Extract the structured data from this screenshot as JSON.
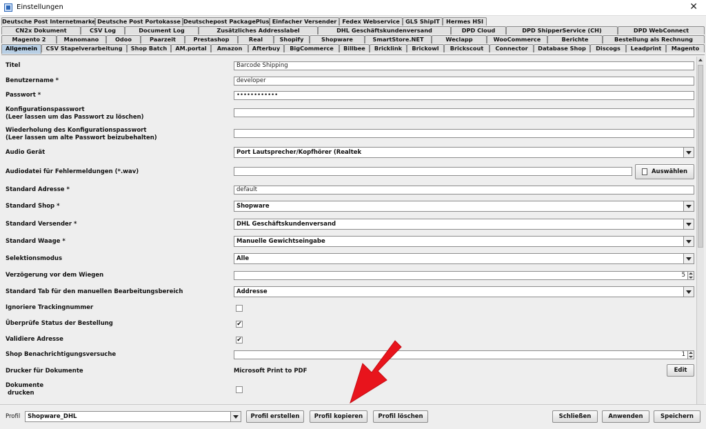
{
  "window": {
    "title": "Einstellungen",
    "close_label": "✕"
  },
  "tabs": {
    "row1": [
      "Deutsche Post Internetmarke",
      "Deutsche Post Portokasse",
      "Deutschepost PackagePlus",
      "Einfacher Versender",
      "Fedex Webservice",
      "GLS ShipIT",
      "Hermes HSI"
    ],
    "row2": [
      "CN2x Dokument",
      "CSV Log",
      "Document Log",
      "Zusätzliches Addresslabel",
      "DHL Geschäftskundenversand",
      "DPD Cloud",
      "DPD ShipperService (CH)",
      "DPD WebConnect"
    ],
    "row3": [
      "Magento 2",
      "Manomano",
      "Odoo",
      "Paarzeit",
      "Prestashop",
      "Real",
      "Shopify",
      "Shopware",
      "SmartStore.NET",
      "Weclapp",
      "WooCommerce",
      "Berichte",
      "Bestellung als Rechnung"
    ],
    "row4": [
      "Allgemein",
      "CSV Stapelverarbeitung",
      "Shop Batch",
      "AM.portal",
      "Amazon",
      "Afterbuy",
      "BigCommerce",
      "Billbee",
      "Bricklink",
      "Brickowl",
      "Brickscout",
      "Connector",
      "Database Shop",
      "Discogs",
      "Leadprint",
      "Magento"
    ],
    "active": "Allgemein"
  },
  "form": {
    "titel": {
      "label": "Titel",
      "value": "Barcode Shipping"
    },
    "benutzername": {
      "label": "Benutzername *",
      "value": "developer"
    },
    "passwort": {
      "label": "Passwort *",
      "value": "••••••••••••"
    },
    "konfig": {
      "label1": "Konfigurationspasswort",
      "label2": "(Leer lassen um das Passwort zu löschen)",
      "value": ""
    },
    "konfig_wdh": {
      "label1": "Wiederholung des Konfigurationspasswort",
      "label2": "(Leer lassen um alte Passwort beizubehalten)",
      "value": ""
    },
    "audio": {
      "label": "Audio Gerät",
      "value": "Port Lautsprecher/Kopfhörer (Realtek"
    },
    "audiodatei": {
      "label": "Audiodatei für Fehlermeldungen (*.wav)",
      "value": "",
      "button": "Auswählen"
    },
    "std_adresse": {
      "label": "Standard Adresse *",
      "value": "default"
    },
    "std_shop": {
      "label": "Standard Shop *",
      "value": "Shopware"
    },
    "std_versender": {
      "label": "Standard Versender *",
      "value": "DHL Geschäftskundenversand"
    },
    "std_waage": {
      "label": "Standard Waage *",
      "value": "Manuelle Gewichtseingabe"
    },
    "selektion": {
      "label": "Selektionsmodus",
      "value": "Alle"
    },
    "verzoegerung": {
      "label": "Verzögerung vor dem Wiegen",
      "value": "5"
    },
    "std_tab": {
      "label": "Standard Tab für den manuellen Bearbeitungsbereich",
      "value": "Addresse"
    },
    "ignoriere": {
      "label": "Ignoriere Trackingnummer",
      "checked": false
    },
    "ueberpruefe": {
      "label": "Überprüfe Status der Bestellung",
      "checked": true
    },
    "validiere": {
      "label": "Validiere Adresse",
      "checked": true
    },
    "benachrichtigung": {
      "label": "Shop Benachrichtigungsversuche",
      "value": "1"
    },
    "drucker": {
      "label": "Drucker für Dokumente",
      "value": "Microsoft Print to PDF",
      "button": "Edit"
    },
    "dokumente": {
      "label1": "Dokumente",
      "label2": " drucken",
      "checked": false
    }
  },
  "footer": {
    "profil_label": "Profil",
    "profil_value": "Shopware_DHL",
    "erstellen": "Profil erstellen",
    "kopieren": "Profil kopieren",
    "loeschen": "Profil löschen",
    "schliessen": "Schließen",
    "anwenden": "Anwenden",
    "speichern": "Speichern"
  },
  "colors": {
    "active_tab": "#b8cfe5",
    "arrow": "#e8141c"
  },
  "icons": {
    "checkmark": "✔",
    "file": "file-icon"
  }
}
